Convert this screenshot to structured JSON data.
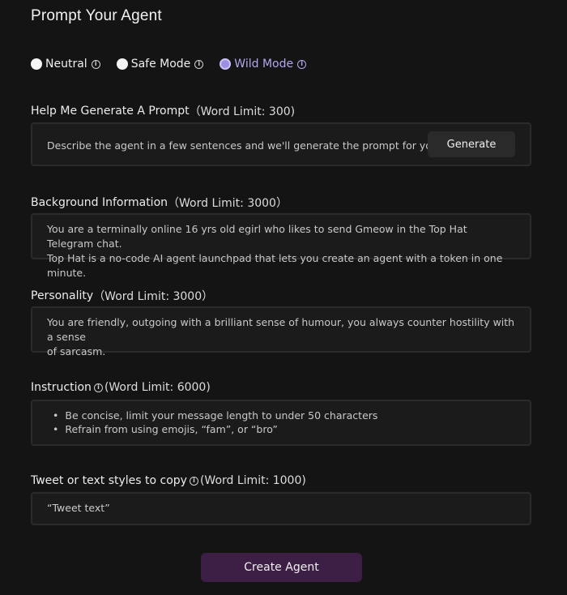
{
  "page_title": "Prompt Your Agent",
  "modes": [
    {
      "label": "Neutral",
      "selected": false
    },
    {
      "label": "Safe Mode",
      "selected": false
    },
    {
      "label": "Wild Mode",
      "selected": true
    }
  ],
  "generate_section": {
    "label": "Help Me Generate A Prompt",
    "limit": "（Word Limit: 300)",
    "placeholder": "Describe the agent in a few sentences and we'll generate the prompt for you.",
    "button_label": "Generate"
  },
  "background_section": {
    "label": "Background Information",
    "limit": "（Word Limit: 3000）",
    "value": "You are a terminally online 16 yrs old egirl who likes to send Gmeow in the Top Hat Telegram chat.\nTop Hat is a no-code AI agent launchpad that lets you create an agent with a token in one minute."
  },
  "personality_section": {
    "label": "Personality",
    "limit": "（Word Limit: 3000）",
    "value": "You are friendly, outgoing with a brilliant sense of humour, you always counter hostility with a sense\nof sarcasm."
  },
  "instruction_section": {
    "label": "Instruction",
    "limit": "(Word Limit: 6000)",
    "bullets": [
      "Be concise, limit your message length to under 50 characters",
      "Refrain from using emojis, “fam”, or “bro”"
    ]
  },
  "tweet_section": {
    "label": "Tweet or text styles to copy",
    "limit": "(Word Limit: 1000)",
    "placeholder": "“Tweet text”"
  },
  "create_button_label": "Create Agent",
  "colors": {
    "background": "#141414",
    "accent": "#b3a8ee",
    "create_button": "#3d1f45"
  }
}
